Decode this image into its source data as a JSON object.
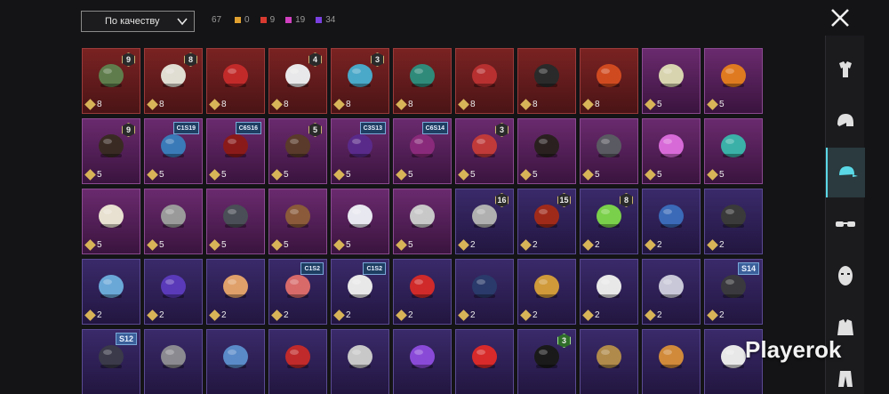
{
  "toolbar": {
    "sort_label": "По качеству",
    "total": "67",
    "counts": [
      {
        "value": "0",
        "color": "#e0a030"
      },
      {
        "value": "9",
        "color": "#d83a30"
      },
      {
        "value": "19",
        "color": "#d040c0"
      },
      {
        "value": "34",
        "color": "#7a40e0"
      }
    ]
  },
  "items": [
    {
      "icon": "zombie-mask-icon",
      "quality": "red",
      "value": "8",
      "badge": "9",
      "badge_type": "level",
      "color": "#5f7d4c"
    },
    {
      "icon": "white-hair-icon",
      "quality": "red",
      "value": "8",
      "badge": "8",
      "badge_type": "level",
      "color": "#e0ddd3"
    },
    {
      "icon": "red-helmet-icon",
      "quality": "red",
      "value": "8",
      "badge": "",
      "badge_type": "",
      "color": "#c22a2a"
    },
    {
      "icon": "snowman-hat-icon",
      "quality": "red",
      "value": "8",
      "badge": "4",
      "badge_type": "level",
      "color": "#e8e8ea"
    },
    {
      "icon": "clown-mask-icon",
      "quality": "red",
      "value": "8",
      "badge": "3",
      "badge_type": "level",
      "color": "#4aa8c8"
    },
    {
      "icon": "dragon-helmet-icon",
      "quality": "red",
      "value": "8",
      "badge": "",
      "badge_type": "",
      "color": "#2f8a7a"
    },
    {
      "icon": "red-mask-icon",
      "quality": "red",
      "value": "8",
      "badge": "",
      "badge_type": "",
      "color": "#b83030"
    },
    {
      "icon": "pirate-hat-icon",
      "quality": "red",
      "value": "8",
      "badge": "",
      "badge_type": "",
      "color": "#2a2a2a"
    },
    {
      "icon": "mech-helmet-icon",
      "quality": "red",
      "value": "8",
      "badge": "",
      "badge_type": "",
      "color": "#d04a20"
    },
    {
      "icon": "blonde-hair-icon",
      "quality": "pink",
      "value": "5",
      "badge": "",
      "badge_type": "",
      "color": "#d8d4b0"
    },
    {
      "icon": "pumpkin-head-icon",
      "quality": "pink",
      "value": "5",
      "badge": "",
      "badge_type": "",
      "color": "#e07a20"
    },
    {
      "icon": "dark-hair-icon",
      "quality": "pink",
      "value": "5",
      "badge": "9",
      "badge_type": "level",
      "color": "#3a2a24"
    },
    {
      "icon": "creature-mask-icon",
      "quality": "pink",
      "value": "5",
      "badge": "C1S19",
      "badge_type": "season",
      "color": "#3a7ab8"
    },
    {
      "icon": "red-hood-icon",
      "quality": "pink",
      "value": "5",
      "badge": "C6S16",
      "badge_type": "season",
      "color": "#8a1a1a"
    },
    {
      "icon": "pigtail-hair-icon",
      "quality": "pink",
      "value": "5",
      "badge": "5",
      "badge_type": "level",
      "color": "#5a3a2a"
    },
    {
      "icon": "purple-cap-icon",
      "quality": "pink",
      "value": "5",
      "badge": "C3S13",
      "badge_type": "season",
      "color": "#5a2a8a"
    },
    {
      "icon": "purple-hair-icon",
      "quality": "pink",
      "value": "5",
      "badge": "C6S14",
      "badge_type": "season",
      "color": "#8a2a7a"
    },
    {
      "icon": "jester-hat-icon",
      "quality": "pink",
      "value": "5",
      "badge": "3",
      "badge_type": "level",
      "color": "#c03a3a"
    },
    {
      "icon": "braided-hair-icon",
      "quality": "pink",
      "value": "5",
      "badge": "",
      "badge_type": "",
      "color": "#2a2020"
    },
    {
      "icon": "biker-helmet-icon",
      "quality": "pink",
      "value": "5",
      "badge": "",
      "badge_type": "",
      "color": "#5a5a62"
    },
    {
      "icon": "alien-helmet-icon",
      "quality": "pink",
      "value": "5",
      "badge": "",
      "badge_type": "",
      "color": "#d86ad8"
    },
    {
      "icon": "goblin-mask-icon",
      "quality": "pink",
      "value": "5",
      "badge": "",
      "badge_type": "",
      "color": "#3ab0a8"
    },
    {
      "icon": "dreadlocks-icon",
      "quality": "pink",
      "value": "5",
      "badge": "",
      "badge_type": "",
      "color": "#e8e0d0"
    },
    {
      "icon": "grey-hair-icon",
      "quality": "pink",
      "value": "5",
      "badge": "",
      "badge_type": "",
      "color": "#9a9a9a"
    },
    {
      "icon": "gas-mask-icon",
      "quality": "pink",
      "value": "5",
      "badge": "",
      "badge_type": "",
      "color": "#4a4e56"
    },
    {
      "icon": "bear-mask-icon",
      "quality": "pink",
      "value": "5",
      "badge": "",
      "badge_type": "",
      "color": "#8a5a3a"
    },
    {
      "icon": "white-helmet-icon",
      "quality": "pink",
      "value": "5",
      "badge": "",
      "badge_type": "",
      "color": "#e8e8f0"
    },
    {
      "icon": "rooster-hat-icon",
      "quality": "pink",
      "value": "5",
      "badge": "",
      "badge_type": "",
      "color": "#c8c8c8"
    },
    {
      "icon": "bunny-helmet-icon",
      "quality": "purple",
      "value": "2",
      "badge": "16",
      "badge_type": "level",
      "color": "#b0b0b0"
    },
    {
      "icon": "devil-hair-icon",
      "quality": "purple",
      "value": "2",
      "badge": "15",
      "badge_type": "level",
      "color": "#a02a1a"
    },
    {
      "icon": "ghost-hood-icon",
      "quality": "purple",
      "value": "2",
      "badge": "8",
      "badge_type": "level",
      "color": "#7ad04a"
    },
    {
      "icon": "sport-cap-icon",
      "quality": "purple",
      "value": "2",
      "badge": "",
      "badge_type": "",
      "color": "#3a6ab8"
    },
    {
      "icon": "robot-mask-icon",
      "quality": "purple",
      "value": "2",
      "badge": "",
      "badge_type": "",
      "color": "#3a3a3a"
    },
    {
      "icon": "dotted-cap-icon",
      "quality": "purple",
      "value": "2",
      "badge": "",
      "badge_type": "",
      "color": "#6aa8d8"
    },
    {
      "icon": "ribbon-bow-icon",
      "quality": "purple",
      "value": "2",
      "badge": "",
      "badge_type": "",
      "color": "#5a3ab8"
    },
    {
      "icon": "cat-ears-icon",
      "quality": "purple",
      "value": "2",
      "badge": "",
      "badge_type": "",
      "color": "#e0a06a"
    },
    {
      "icon": "striped-beanie-icon",
      "quality": "purple",
      "value": "2",
      "badge": "C1S2",
      "badge_type": "season",
      "color": "#d86a6a"
    },
    {
      "icon": "chef-mask-icon",
      "quality": "purple",
      "value": "2",
      "badge": "C1S2",
      "badge_type": "season",
      "color": "#e8e8e8"
    },
    {
      "icon": "feather-crest-icon",
      "quality": "purple",
      "value": "2",
      "badge": "",
      "badge_type": "",
      "color": "#d02a2a"
    },
    {
      "icon": "navy-cap-icon",
      "quality": "purple",
      "value": "2",
      "badge": "",
      "badge_type": "",
      "color": "#2a3a6a"
    },
    {
      "icon": "mustard-beanie-icon",
      "quality": "purple",
      "value": "2",
      "badge": "",
      "badge_type": "",
      "color": "#d09a3a"
    },
    {
      "icon": "flag-mushroom-hat-icon",
      "quality": "purple",
      "value": "2",
      "badge": "",
      "badge_type": "",
      "color": "#e8e8e8"
    },
    {
      "icon": "ufo-hat-icon",
      "quality": "purple",
      "value": "2",
      "badge": "",
      "badge_type": "",
      "color": "#c8c8d8"
    },
    {
      "icon": "knight-helmet-icon",
      "quality": "purple",
      "value": "2",
      "badge": "S14",
      "badge_type": "season-big",
      "color": "#3a3a3e"
    },
    {
      "icon": "motorcycle-helmet-icon",
      "quality": "purple",
      "value": "",
      "badge": "S12",
      "badge_type": "season-big",
      "color": "#3a3a4a"
    },
    {
      "icon": "silver-helmet-icon",
      "quality": "purple",
      "value": "",
      "badge": "",
      "badge_type": "",
      "color": "#8a8a90"
    },
    {
      "icon": "shark-hat-icon",
      "quality": "purple",
      "value": "",
      "badge": "",
      "badge_type": "",
      "color": "#5a8ac8"
    },
    {
      "icon": "red-fedora-icon",
      "quality": "purple",
      "value": "",
      "badge": "",
      "badge_type": "",
      "color": "#c02a2a"
    },
    {
      "icon": "shark-head-icon",
      "quality": "purple",
      "value": "",
      "badge": "",
      "badge_type": "",
      "color": "#c8c8c8"
    },
    {
      "icon": "flower-crown-icon",
      "quality": "purple",
      "value": "",
      "badge": "",
      "badge_type": "",
      "color": "#8a4ad8"
    },
    {
      "icon": "red-bucket-hat-icon",
      "quality": "purple",
      "value": "",
      "badge": "",
      "badge_type": "",
      "color": "#d82a2a"
    },
    {
      "icon": "black-fedora-icon",
      "quality": "purple",
      "value": "",
      "badge": "3",
      "badge_type": "level-green",
      "color": "#1a1a1a"
    },
    {
      "icon": "scarecrow-hat-icon",
      "quality": "purple",
      "value": "",
      "badge": "",
      "badge_type": "",
      "color": "#b08a4a"
    },
    {
      "icon": "burger-hat-icon",
      "quality": "purple",
      "value": "",
      "badge": "",
      "badge_type": "",
      "color": "#d08a3a"
    },
    {
      "icon": "visor-icon",
      "quality": "purple",
      "value": "",
      "badge": "",
      "badge_type": "",
      "color": "#e8e8e8"
    }
  ],
  "sidebar": {
    "close_icon": "close-icon",
    "categories": [
      {
        "icon": "outfit-icon",
        "active": false
      },
      {
        "icon": "helmet-icon",
        "active": false
      },
      {
        "icon": "cap-icon",
        "active": true
      },
      {
        "icon": "glasses-icon",
        "active": false
      },
      {
        "icon": "mask-icon",
        "active": false
      },
      {
        "icon": "jacket-icon",
        "active": false
      },
      {
        "icon": "pants-icon",
        "active": false
      }
    ]
  },
  "watermark": "Playerok"
}
